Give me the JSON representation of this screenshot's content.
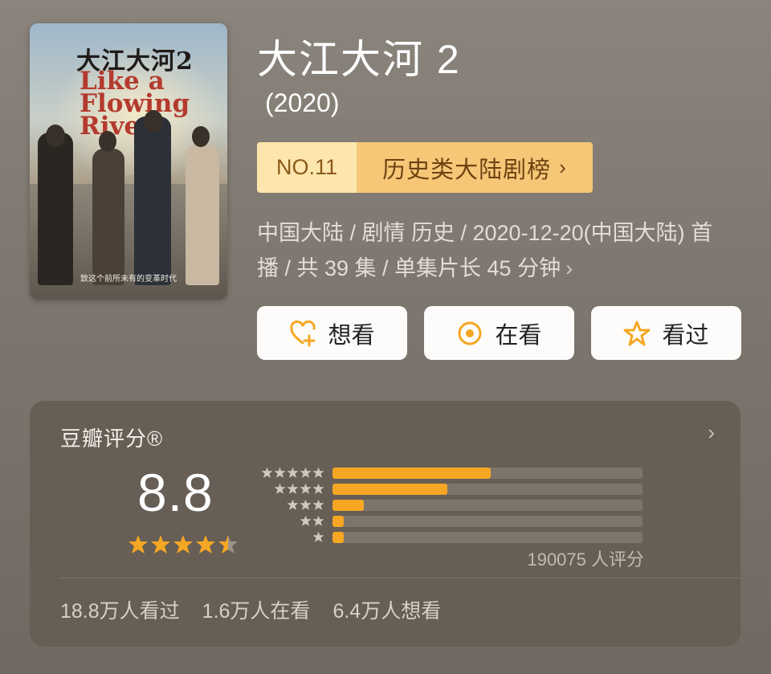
{
  "poster": {
    "cn_title": "大江大河2",
    "en_title_lines": [
      "Like a",
      "Flowing",
      "River"
    ],
    "slogan": "致这个前所未有的变革时代"
  },
  "title": "大江大河 2",
  "year": "(2020)",
  "rank": {
    "no": "NO.11",
    "category": "历史类大陆剧榜",
    "chevron": "›"
  },
  "meta": {
    "line1": "中国大陆 / 剧情 历史 / 2020-12-20(中国大陆) 首",
    "line2": "播 / 共 39 集 / 单集片长 45 分钟",
    "chevron": "›"
  },
  "buttons": {
    "want": "想看",
    "watching": "在看",
    "watched": "看过"
  },
  "rating": {
    "label": "豆瓣评分®",
    "chevron": "›",
    "score": "8.8",
    "stars_value": 4.5,
    "distribution": [
      {
        "stars": 5,
        "fraction": 0.51
      },
      {
        "stars": 4,
        "fraction": 0.37
      },
      {
        "stars": 3,
        "fraction": 0.1
      },
      {
        "stars": 2,
        "fraction": 0.03
      },
      {
        "stars": 1,
        "fraction": 0.03
      }
    ],
    "count_text": "190075 人评分"
  },
  "stats": {
    "watched": "18.8万人看过",
    "watching": "1.6万人在看",
    "want": "6.4万人想看"
  },
  "colors": {
    "accent": "#f5a623",
    "rank_light": "#fde6ad",
    "rank_dark": "#f5c777",
    "panel": "#675e55"
  }
}
